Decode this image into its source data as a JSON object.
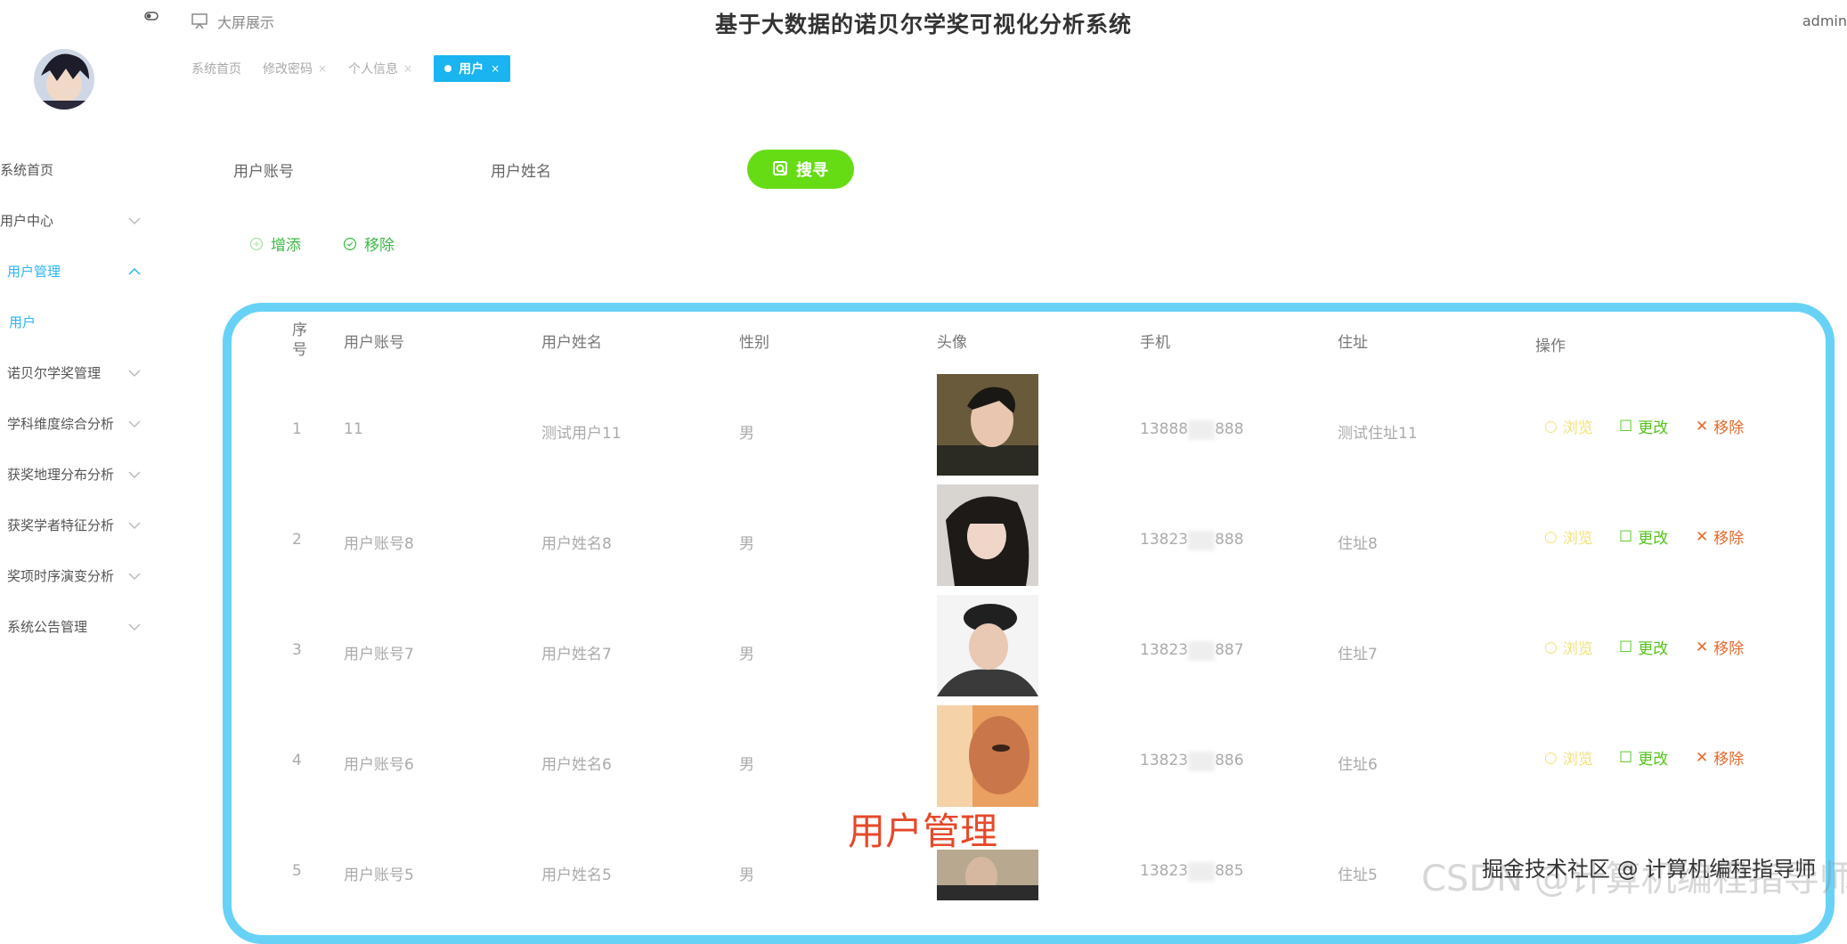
{
  "header": {
    "title": "基于大数据的诺贝尔学奖可视化分析系统",
    "big_screen_label": "大屏展示",
    "user": "admin"
  },
  "tabs": [
    {
      "label": "系统首页"
    },
    {
      "label": "修改密码"
    },
    {
      "label": "个人信息"
    }
  ],
  "active_tab": {
    "label": "用户",
    "close": "×"
  },
  "sidebar": {
    "items": [
      {
        "label": "系统首页"
      },
      {
        "label": "用户中心"
      },
      {
        "label": "用户管理"
      },
      {
        "label": "用户"
      },
      {
        "label": "诺贝尔学奖管理"
      },
      {
        "label": "学科维度综合分析"
      },
      {
        "label": "获奖地理分布分析"
      },
      {
        "label": "获奖学者特征分析"
      },
      {
        "label": "奖项时序演变分析"
      },
      {
        "label": "系统公告管理"
      }
    ]
  },
  "search": {
    "account_label": "用户账号",
    "name_label": "用户姓名",
    "button_label": "搜寻"
  },
  "actions": {
    "add_label": "增添",
    "remove_label": "移除"
  },
  "table": {
    "headers": {
      "index": "序\n号",
      "account": "用户账号",
      "name": "用户姓名",
      "gender": "性别",
      "avatar": "头像",
      "phone": "手机",
      "address": "住址",
      "ops": "操作"
    },
    "rows": [
      {
        "index": "1",
        "account": "11",
        "name": "测试用户11",
        "gender": "男",
        "phone": "13888",
        "phone_tail": "888",
        "address": "测试住址11"
      },
      {
        "index": "2",
        "account": "用户账号8",
        "name": "用户姓名8",
        "gender": "男",
        "phone": "13823",
        "phone_tail": "888",
        "address": "住址8"
      },
      {
        "index": "3",
        "account": "用户账号7",
        "name": "用户姓名7",
        "gender": "男",
        "phone": "13823",
        "phone_tail": "887",
        "address": "住址7"
      },
      {
        "index": "4",
        "account": "用户账号6",
        "name": "用户姓名6",
        "gender": "男",
        "phone": "13823",
        "phone_tail": "886",
        "address": "住址6"
      },
      {
        "index": "5",
        "account": "用户账号5",
        "name": "用户姓名5",
        "gender": "男",
        "phone": "13823",
        "phone_tail": "885",
        "address": "住址5"
      }
    ],
    "ops": {
      "view": "浏览",
      "edit": "更改",
      "delete": "移除"
    }
  },
  "overlay": {
    "caption": "用户管理",
    "watermark_main": "掘金技术社区 @ 计算机编程指导师",
    "watermark_faint": "CSDN @计算机编程指导师"
  },
  "colors": {
    "accent": "#1ab4f0",
    "search_button": "#66dc14",
    "panel_border": "#68d2f6",
    "edit": "#52c41a",
    "delete": "#e26a2c",
    "view": "#f2e27a"
  }
}
